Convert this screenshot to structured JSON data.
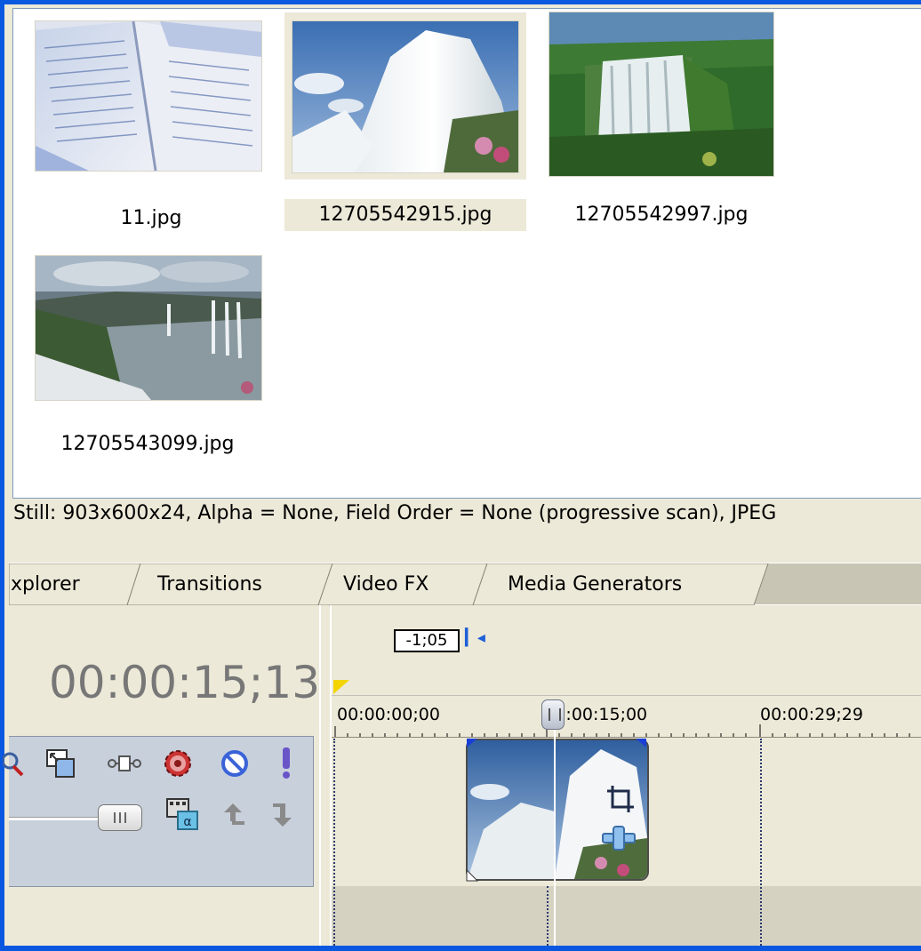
{
  "explorer": {
    "files": [
      {
        "name": "11.jpg",
        "selected": false
      },
      {
        "name": "12705542915.jpg",
        "selected": true
      },
      {
        "name": "12705542997.jpg",
        "selected": false
      },
      {
        "name": "12705543099.jpg",
        "selected": false
      }
    ]
  },
  "status_bar": {
    "text": "Still: 903x600x24, Alpha = None, Field Order = None (progressive scan), JPEG"
  },
  "tabs": [
    {
      "label": "xplorer",
      "active": false
    },
    {
      "label": "Transitions",
      "active": false
    },
    {
      "label": "Video FX",
      "active": false
    },
    {
      "label": "Media Generators",
      "active": false
    }
  ],
  "track": {
    "timecode": "00:00:15;13"
  },
  "timeline": {
    "offset": "-1;05",
    "ruler_labels": [
      "00:00:00;00",
      "00:00:15;00",
      "00:00:29;29"
    ],
    "ruler_label_fragment": "):00:15;00"
  },
  "colors": {
    "window_border": "#0a58e0",
    "background": "#ece9d8",
    "track_header": "#c8d0dc",
    "selection": "#ece9d8"
  }
}
